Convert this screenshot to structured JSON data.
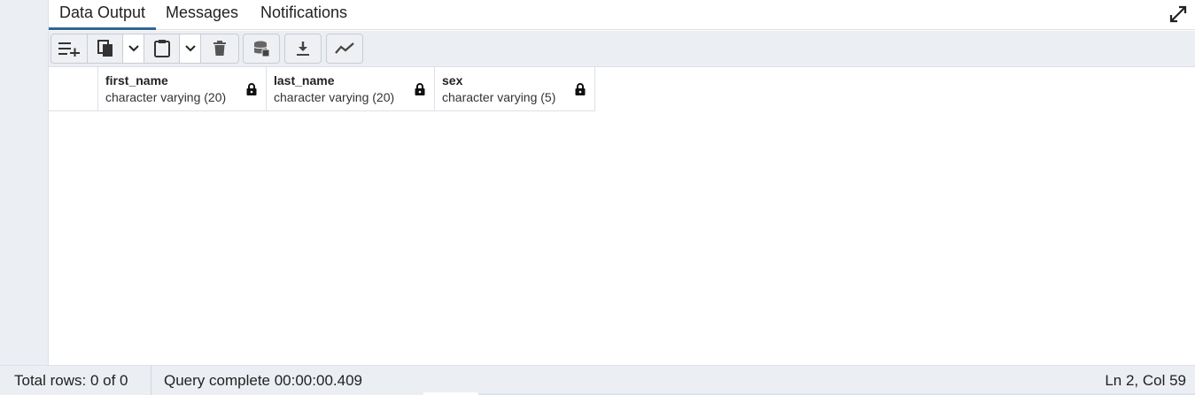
{
  "tabs": [
    {
      "label": "Data Output",
      "active": true
    },
    {
      "label": "Messages",
      "active": false
    },
    {
      "label": "Notifications",
      "active": false
    }
  ],
  "toolbar": {
    "icons": [
      "add-row-icon",
      "copy-icon",
      "chevron-down-icon",
      "paste-icon",
      "chevron-down-icon",
      "delete-icon",
      "save-data-icon",
      "download-icon",
      "graph-visualiser-icon"
    ]
  },
  "grid": {
    "columns": [
      {
        "name": "first_name",
        "type": "character varying (20)"
      },
      {
        "name": "last_name",
        "type": "character varying (20)"
      },
      {
        "name": "sex",
        "type": "character varying (5)"
      }
    ],
    "rows": []
  },
  "status": {
    "total_rows": "Total rows: 0 of 0",
    "query": "Query complete 00:00:00.409",
    "position": "Ln 2, Col 59"
  },
  "colors": {
    "accent": "#326690",
    "toolbar_bg": "#ebeef3",
    "border": "#dde0e6"
  }
}
